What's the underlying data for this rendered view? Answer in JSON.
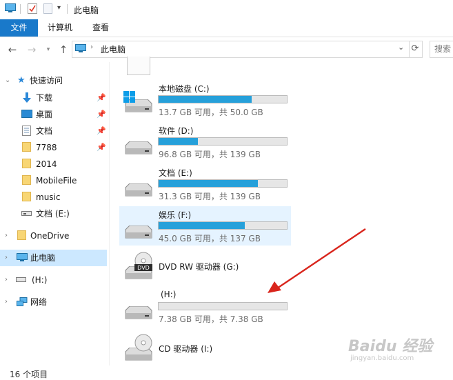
{
  "window": {
    "title": "此电脑"
  },
  "ribbon": {
    "tabs": [
      {
        "label": "文件"
      },
      {
        "label": "计算机"
      },
      {
        "label": "查看"
      }
    ]
  },
  "address": {
    "path": "此电脑",
    "search_placeholder": "搜索"
  },
  "nav": {
    "quick_access": "快速访问",
    "items": [
      {
        "label": "下载",
        "pinned": true
      },
      {
        "label": "桌面",
        "pinned": true
      },
      {
        "label": "文档",
        "pinned": true
      },
      {
        "label": "7788",
        "pinned": true
      },
      {
        "label": "2014"
      },
      {
        "label": "MobileFile"
      },
      {
        "label": "music"
      },
      {
        "label": "文档 (E:)"
      }
    ],
    "onedrive": "OneDrive",
    "thispc": "此电脑",
    "h_drive": "(H:)",
    "network": "网络"
  },
  "drives": [
    {
      "name": "本地磁盘 (C:)",
      "info": "13.7 GB 可用，共 50.0 GB",
      "used_fraction": 0.726
    },
    {
      "name": "软件 (D:)",
      "info": "96.8 GB 可用，共 139 GB",
      "used_fraction": 0.304
    },
    {
      "name": "文档 (E:)",
      "info": "31.3 GB 可用，共 139 GB",
      "used_fraction": 0.775
    },
    {
      "name": "娱乐 (F:)",
      "info": "45.0 GB 可用，共 137 GB",
      "used_fraction": 0.672
    },
    {
      "name": "DVD RW 驱动器 (G:)"
    },
    {
      "name": "(H:)",
      "info": "7.38 GB 可用，共 7.38 GB",
      "used_fraction": 0.0
    },
    {
      "name": "CD 驱动器 (I:)"
    }
  ],
  "status": {
    "count": "16 个项目"
  },
  "colors": {
    "accent": "#1979ca",
    "bar_fill": "#26a0da",
    "selection": "#cce8ff",
    "arrow": "#d9251c"
  },
  "watermark": {
    "text": "Baidu经验",
    "url": "jingyan.baidu.com"
  }
}
